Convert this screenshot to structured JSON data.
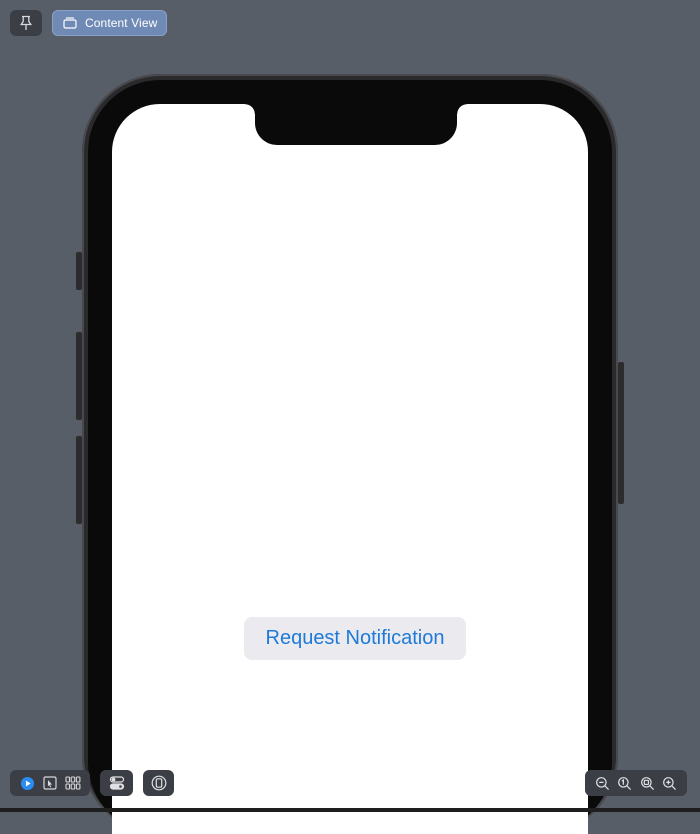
{
  "toolbar_top": {
    "pin_icon": "pin-icon",
    "preview_tab_label": "Content View",
    "preview_tab_icon": "content-view-icon"
  },
  "screen": {
    "button_label": "Request Notification"
  },
  "toolbar_bottom": {
    "left_icons": [
      "live-preview-icon",
      "selectable-mode-icon",
      "variants-grid-icon"
    ],
    "settings_icon": "device-settings-icon",
    "device_icon": "device-icon",
    "zoom_icons": [
      "zoom-out-icon",
      "zoom-to-fit-icon",
      "zoom-100-icon",
      "zoom-in-icon"
    ]
  },
  "colors": {
    "canvas": "#575e68",
    "accent_blue": "#1d7ad8",
    "tab_bg": "#6f8ab4",
    "button_bg": "#ebebef"
  }
}
